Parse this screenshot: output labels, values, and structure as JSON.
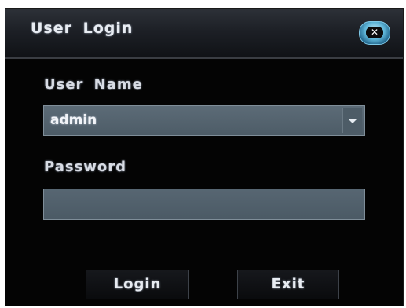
{
  "dialog": {
    "title": "User Login",
    "close_icon": "close-icon"
  },
  "username": {
    "label": "User Name",
    "value": "admin",
    "dropdown_icon": "chevron-down-icon"
  },
  "password": {
    "label": "Password",
    "value": ""
  },
  "buttons": {
    "login_label": "Login",
    "exit_label": "Exit"
  },
  "colors": {
    "dialog_background": "#040404",
    "field_background": "#536270",
    "close_button_accent": "#5fb6d8"
  }
}
